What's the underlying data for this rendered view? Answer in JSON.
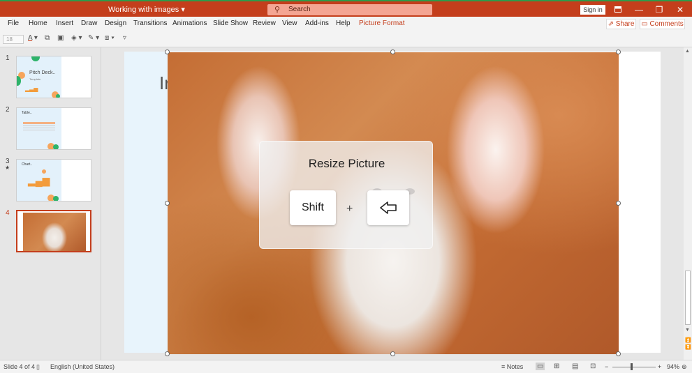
{
  "titlebar": {
    "doc_title": "Working with images ▾",
    "search_placeholder": "Search",
    "sign_in": "Sign in",
    "ribbon_icon": "ribbon-display-icon",
    "minimize": "—",
    "restore": "❐",
    "close": "✕",
    "accent_color": "#c43e1c"
  },
  "ribbon": {
    "tabs": [
      "File",
      "Home",
      "Insert",
      "Draw",
      "Design",
      "Transitions",
      "Animations",
      "Slide Show",
      "Review",
      "View",
      "Add-ins",
      "Help",
      "Picture Format"
    ],
    "active_tab": "Picture Format",
    "share": "Share",
    "comments": "Comments"
  },
  "toolbar": {
    "font_size": "18",
    "font_color_glyph": "A",
    "tools": [
      "copy-icon",
      "crop-icon",
      "fill-icon",
      "outline-icon",
      "arrange-icon",
      "more-icon"
    ]
  },
  "thumbnails": [
    {
      "number": "1",
      "title": "Pitch Deck..",
      "subtitle": "Template"
    },
    {
      "number": "2",
      "title": "Table.."
    },
    {
      "number": "3",
      "title": "Chart..",
      "star": "★"
    },
    {
      "number": "4",
      "active": true
    }
  ],
  "slide": {
    "title_fragment": "Ir"
  },
  "overlay": {
    "title": "Resize Picture",
    "key1": "Shift",
    "plus": "+",
    "key2_icon": "left-arrow-icon"
  },
  "statusbar": {
    "slide_info": "Slide 4 of 4",
    "language": "English (United States)",
    "notes": "Notes",
    "zoom_minus": "−",
    "zoom_plus": "+",
    "zoom_level": "94%"
  }
}
